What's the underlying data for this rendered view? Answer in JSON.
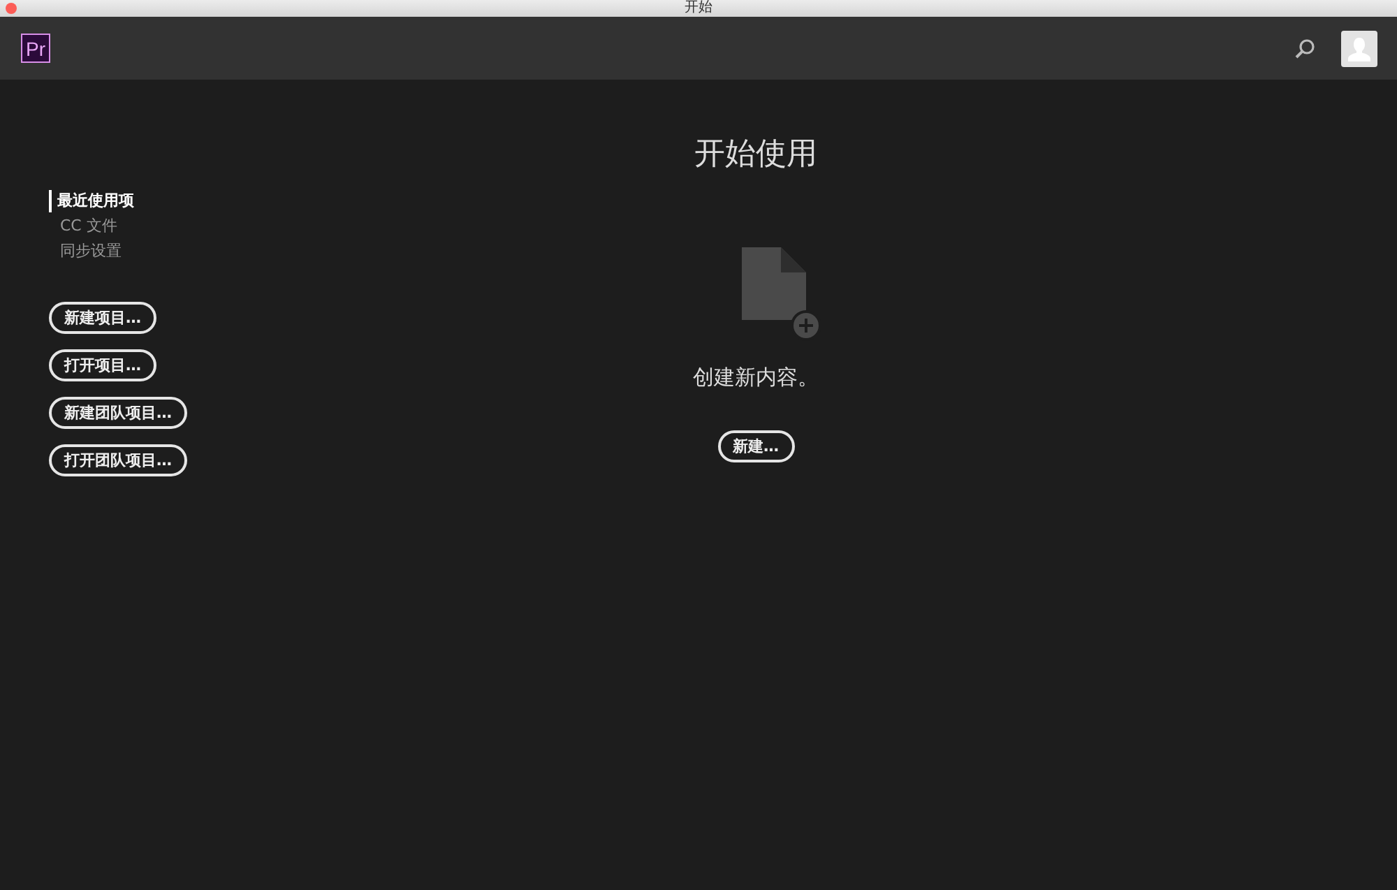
{
  "window": {
    "title": "开始"
  },
  "header": {
    "app_logo": "Pr"
  },
  "sidebar": {
    "items": [
      {
        "label": "最近使用项",
        "selected": true
      },
      {
        "label": "CC 文件",
        "selected": false
      },
      {
        "label": "同步设置",
        "selected": false
      }
    ],
    "buttons": [
      "新建项目…",
      "打开项目…",
      "新建团队项目…",
      "打开团队项目…"
    ]
  },
  "main": {
    "title": "开始使用",
    "empty_message": "创建新内容。",
    "button": "新建…"
  }
}
